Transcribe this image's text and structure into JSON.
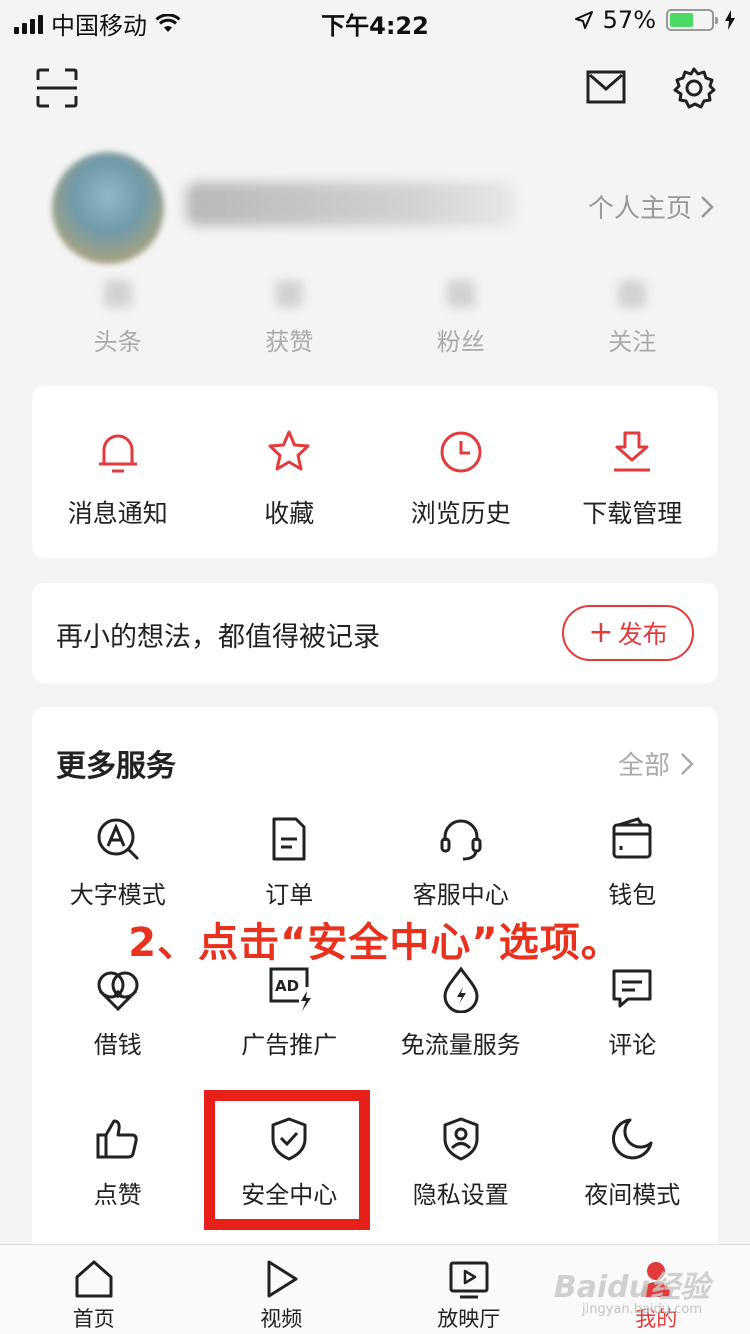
{
  "status_bar": {
    "carrier": "中国移动",
    "time": "下午4:22",
    "battery": "57%",
    "battery_level": 0.57
  },
  "header": {
    "scan_icon": "scan-icon",
    "mail_icon": "mail-icon",
    "settings_icon": "gear-icon"
  },
  "profile": {
    "home_link": "个人主页",
    "stats": [
      {
        "label": "头条"
      },
      {
        "label": "获赞"
      },
      {
        "label": "粉丝"
      },
      {
        "label": "关注"
      }
    ]
  },
  "quick_actions": [
    {
      "label": "消息通知",
      "icon": "bell-icon"
    },
    {
      "label": "收藏",
      "icon": "star-icon"
    },
    {
      "label": "浏览历史",
      "icon": "clock-icon"
    },
    {
      "label": "下载管理",
      "icon": "download-icon"
    }
  ],
  "publish": {
    "prompt": "再小的想法，都值得被记录",
    "button": "发布"
  },
  "services": {
    "title": "更多服务",
    "all_link": "全部",
    "items": [
      {
        "label": "大字模式",
        "icon": "large-font-icon"
      },
      {
        "label": "订单",
        "icon": "order-icon"
      },
      {
        "label": "客服中心",
        "icon": "headset-icon"
      },
      {
        "label": "钱包",
        "icon": "wallet-icon"
      },
      {
        "label": "借钱",
        "icon": "loan-icon"
      },
      {
        "label": "广告推广",
        "icon": "ad-icon"
      },
      {
        "label": "免流量服务",
        "icon": "data-drop-icon"
      },
      {
        "label": "评论",
        "icon": "comment-icon"
      },
      {
        "label": "点赞",
        "icon": "thumbs-up-icon"
      },
      {
        "label": "安全中心",
        "icon": "shield-icon"
      },
      {
        "label": "隐私设置",
        "icon": "privacy-icon"
      },
      {
        "label": "夜间模式",
        "icon": "moon-icon"
      }
    ]
  },
  "annotation": "2、点击“安全中心”选项。",
  "tabbar": [
    {
      "label": "首页",
      "icon": "home-icon"
    },
    {
      "label": "视频",
      "icon": "play-icon"
    },
    {
      "label": "放映厅",
      "icon": "tv-icon"
    },
    {
      "label": "我的",
      "icon": "user-icon",
      "active": true
    }
  ],
  "watermark": {
    "text": "Baidu经验",
    "sub": "jingyan.baidu.com"
  },
  "colors": {
    "accent": "#e33b3b",
    "annotation": "#e8321e",
    "highlight": "#e8201a"
  }
}
